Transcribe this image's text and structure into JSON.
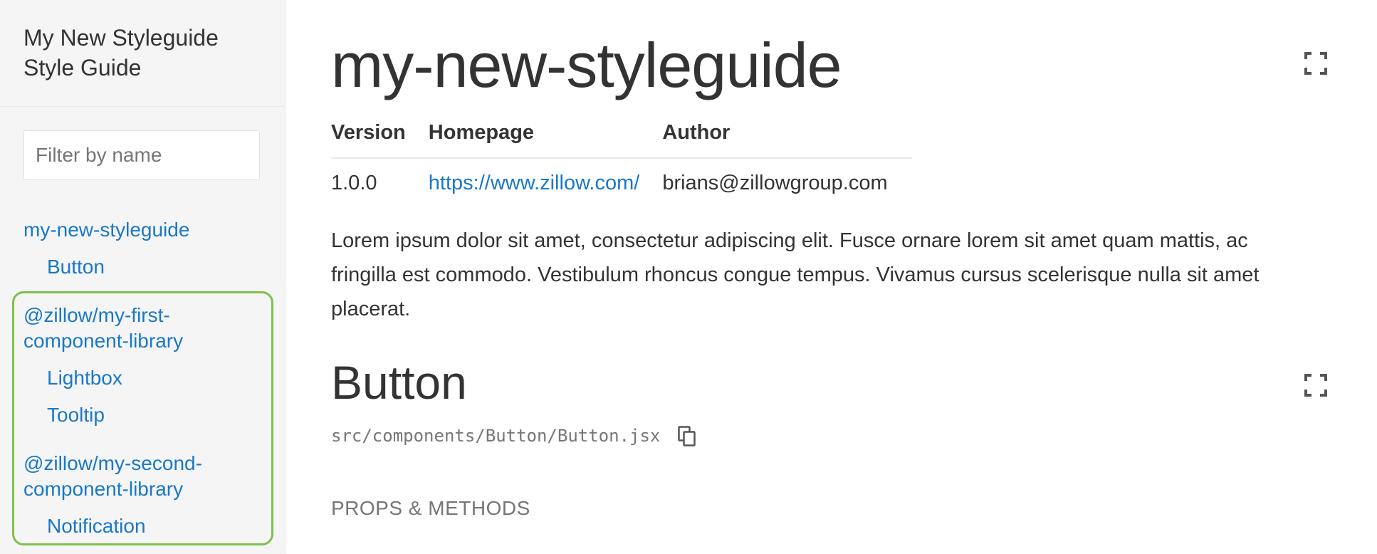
{
  "sidebar": {
    "title": "My New Styleguide Style Guide",
    "filter_placeholder": "Filter by name",
    "nav": [
      {
        "label": "my-new-styleguide",
        "children": [
          "Button"
        ]
      },
      {
        "label": "@zillow/my-first-component-library",
        "label_lines": [
          "@zillow/my-first-",
          "component-library"
        ],
        "children": [
          "Lightbox",
          "Tooltip"
        ]
      },
      {
        "label": "@zillow/my-second-component-library",
        "label_lines": [
          "@zillow/my-second-",
          "component-library"
        ],
        "children": [
          "Notification"
        ]
      }
    ],
    "highlight_color": "#7dc14a"
  },
  "main": {
    "title": "my-new-styleguide",
    "meta": {
      "headers": [
        "Version",
        "Homepage",
        "Author"
      ],
      "values": [
        "1.0.0",
        "https://www.zillow.com/",
        "brians@zillowgroup.com"
      ]
    },
    "description": "Lorem ipsum dolor sit amet, consectetur adipiscing elit. Fusce ornare lorem sit amet quam mattis, ac fringilla est commodo. Vestibulum rhoncus congue tempus. Vivamus cursus scelerisque nulla sit amet placerat.",
    "section": {
      "title": "Button",
      "path": "src/components/Button/Button.jsx",
      "props_heading": "PROPS & METHODS"
    },
    "icons": {
      "expand": "fullscreen-icon",
      "copy": "copy-icon"
    }
  },
  "colors": {
    "link": "#1978c8",
    "text": "#333333",
    "muted": "#767676",
    "sidebar_bg": "#f5f5f5"
  }
}
